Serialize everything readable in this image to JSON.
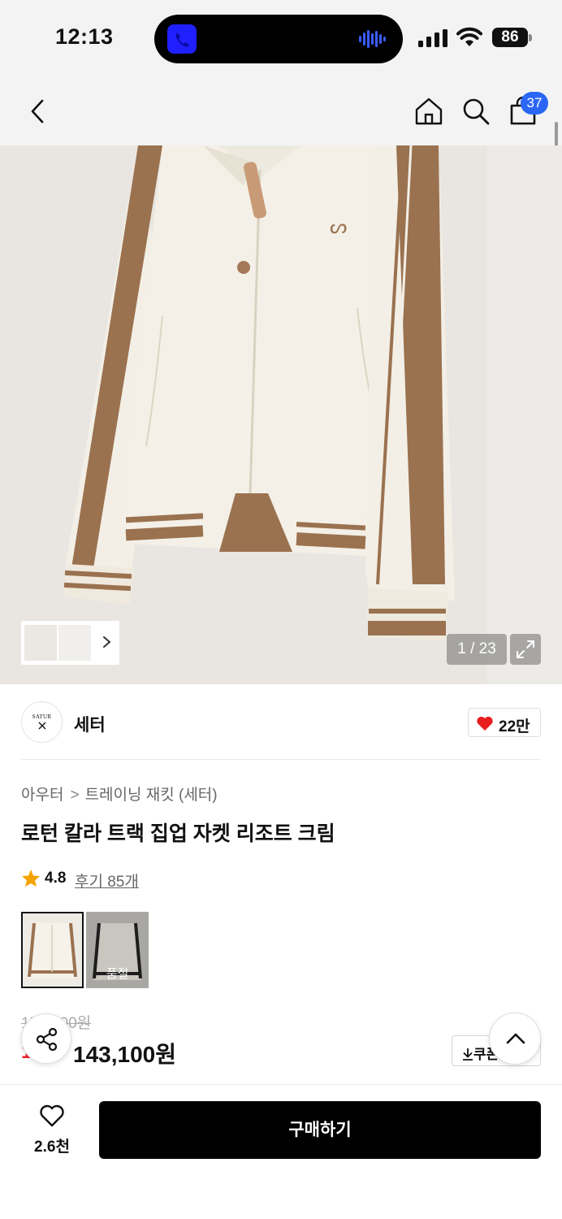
{
  "status_bar": {
    "time": "12:13",
    "battery": "86"
  },
  "nav": {
    "cart_count": "37",
    "icons": [
      "back-arrow-icon",
      "home-icon",
      "search-icon",
      "shopping-bag-icon"
    ]
  },
  "gallery": {
    "counter": "1 / 23",
    "accent_color": "#9a7250"
  },
  "brand": {
    "logo_text": "SATUR",
    "name": "세터",
    "likes": "22만"
  },
  "product": {
    "breadcrumb": [
      "아우터",
      "트레이닝 재킷 (세터)"
    ],
    "title": "로턴 칼라 트랙 집업 자켓 리조트 크림",
    "rating": "4.8",
    "reviews": "후기 85개",
    "variants": [
      {
        "color": "#9a7250",
        "selected": true,
        "label": ""
      },
      {
        "color": "#1d1d1d",
        "selected": false,
        "label": "품절"
      }
    ],
    "original_price": "159,000원",
    "discount": "10%",
    "price": "143,100원",
    "coupon_label": "쿠폰"
  },
  "bottom_bar": {
    "wish_count": "2.6천",
    "buy_label": "구매하기"
  }
}
